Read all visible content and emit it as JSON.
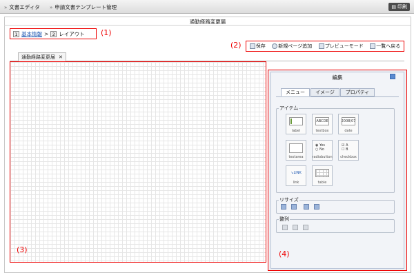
{
  "topbar": {
    "crumb1": "文書エディタ",
    "crumb2": "申請文書テンプレート管理",
    "print_label": "印刷"
  },
  "page": {
    "title": "通勤経路変更届"
  },
  "steps": {
    "step1_num": "1",
    "step1_label": "基本情報",
    "sep": ">",
    "step2_num": "2",
    "step2_label": "レイアウト"
  },
  "annotations": {
    "a1": "(1)",
    "a2": "(2)",
    "a3": "(3)",
    "a4": "(4)"
  },
  "toolbar": {
    "save": "保存",
    "new_page": "新規ページ追加",
    "preview": "プレビューモード",
    "back": "一覧へ戻る"
  },
  "doc_tab": {
    "label": "通勤経路変更届",
    "close": "✕"
  },
  "panel": {
    "title": "編集",
    "tabs": [
      "メニュー",
      "イメージ",
      "プロパティ"
    ],
    "items_group": "アイテム",
    "items": [
      "label",
      "textbox",
      "date",
      "textarea",
      "radiobutton",
      "checkbox",
      "link",
      "table"
    ],
    "thumb_text": {
      "textbox": "ABCDE",
      "date": "2008/07",
      "yes": "Yes",
      "no": "No",
      "a": "A",
      "b": "B",
      "link": "LINK"
    },
    "resize_group": "リサイズ",
    "align_group": "整列"
  },
  "colors": {
    "annotation": "#e00000",
    "link": "#1a55b0",
    "grid": "#e6e6e6"
  }
}
